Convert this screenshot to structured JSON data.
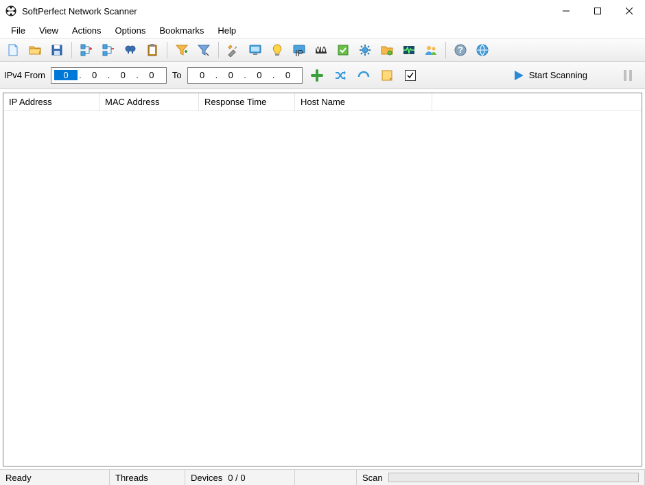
{
  "window": {
    "title": "SoftPerfect Network Scanner"
  },
  "menu": {
    "items": [
      "File",
      "View",
      "Actions",
      "Options",
      "Bookmarks",
      "Help"
    ]
  },
  "toolbar": {
    "icons": [
      "new-file-icon",
      "open-folder-icon",
      "save-icon",
      "expand-tree-icon",
      "collapse-tree-icon",
      "find-icon",
      "clipboard-icon",
      "filter-add-icon",
      "filter-icon",
      "tools-icon",
      "monitor-icon",
      "hint-icon",
      "ip-icon",
      "wmi-icon",
      "actions-icon",
      "settings-gear-icon",
      "shared-folder-icon",
      "activity-icon",
      "users-icon",
      "help-icon",
      "web-icon"
    ]
  },
  "range": {
    "proto_label": "IPv4 From",
    "to_label": "To",
    "from": [
      "0",
      "0",
      "0",
      "0"
    ],
    "to": [
      "0",
      "0",
      "0",
      "0"
    ],
    "start_label": "Start Scanning"
  },
  "columns": [
    "IP Address",
    "MAC Address",
    "Response Time",
    "Host Name"
  ],
  "status": {
    "ready": "Ready",
    "threads_label": "Threads",
    "devices_label": "Devices",
    "devices_value": "0 / 0",
    "scan_label": "Scan"
  }
}
